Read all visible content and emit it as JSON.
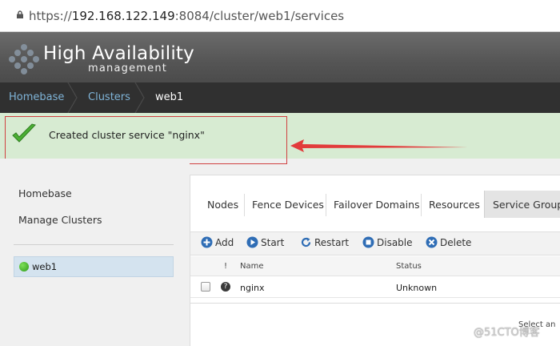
{
  "browser": {
    "url_prefix": "https://",
    "url_host": "192.168.122.149",
    "url_rest": ":8084/cluster/web1/services"
  },
  "header": {
    "title": "High Availability",
    "subtitle": "management"
  },
  "breadcrumb": [
    "Homebase",
    "Clusters",
    "web1"
  ],
  "notification": {
    "message": "Created cluster service \"nginx\"",
    "highlight_color": "#d04040",
    "background": "#d7ebd2"
  },
  "sidebar": {
    "links": [
      "Homebase",
      "Manage Clusters"
    ],
    "clusters": [
      {
        "name": "web1",
        "status": "online"
      }
    ]
  },
  "tabs": {
    "items": [
      "Nodes",
      "Fence Devices",
      "Failover Domains",
      "Resources",
      "Service Groups"
    ],
    "active": "Service Groups"
  },
  "toolbar": {
    "add": "Add",
    "start": "Start",
    "restart": "Restart",
    "disable": "Disable",
    "delete": "Delete"
  },
  "table": {
    "columns": [
      "!",
      "Name",
      "Status"
    ],
    "rows": [
      {
        "name": "nginx",
        "status": "Unknown"
      }
    ]
  },
  "detail": {
    "hint": "Select an"
  },
  "watermark": "@51CTO博客",
  "colors": {
    "accent": "#2f6db5",
    "breadcrumb_link": "#7fb4d8",
    "active_dot": "#2e9a1a"
  }
}
